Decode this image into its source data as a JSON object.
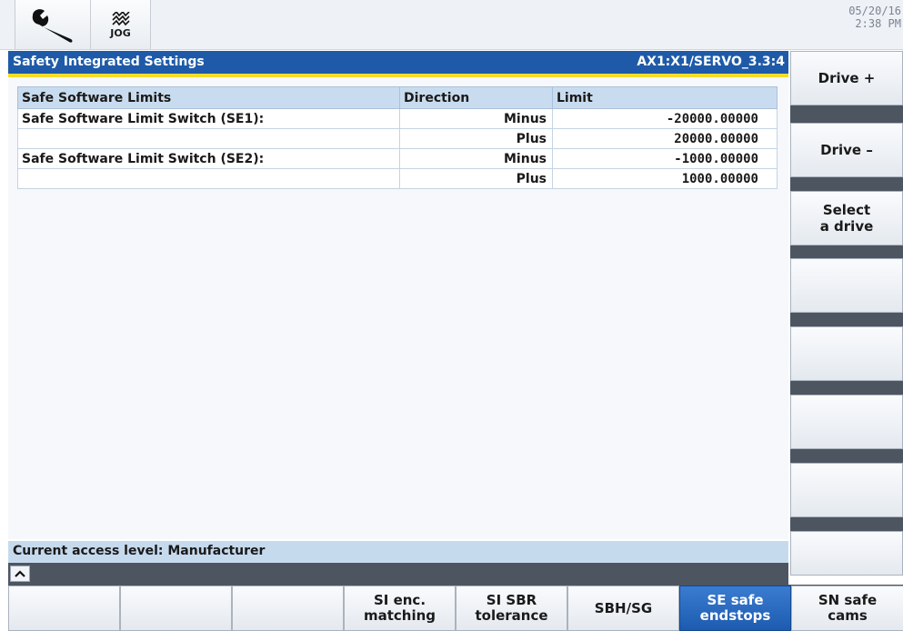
{
  "header": {
    "wrench_icon": "wrench-icon",
    "jog_icon": "jog-mode-icon",
    "jog_label": "JOG",
    "date": "05/20/16",
    "time": "2:38 PM"
  },
  "titlebar": {
    "title": "Safety Integrated Settings",
    "axis": "AX1:X1/SERVO_3.3:4"
  },
  "table": {
    "headers": [
      "Safe Software Limits",
      "Direction",
      "Limit"
    ],
    "rows": [
      {
        "name": "Safe Software Limit Switch (SE1):",
        "direction": "Minus",
        "limit": "-20000.00000"
      },
      {
        "name": "",
        "direction": "Plus",
        "limit": "20000.00000"
      },
      {
        "name": "Safe Software Limit Switch (SE2):",
        "direction": "Minus",
        "limit": "-1000.00000"
      },
      {
        "name": "",
        "direction": "Plus",
        "limit": "1000.00000"
      }
    ]
  },
  "status": {
    "access_level": "Current access level: Manufacturer",
    "caret": "^"
  },
  "right_softkeys": [
    "Drive +",
    "Drive –",
    "Select\na drive",
    "",
    "",
    "",
    "",
    ""
  ],
  "bottom_softkeys": [
    {
      "label": "",
      "active": false
    },
    {
      "label": "",
      "active": false
    },
    {
      "label": "",
      "active": false
    },
    {
      "label": "SI enc.\nmatching",
      "active": false
    },
    {
      "label": "SI SBR\ntolerance",
      "active": false
    },
    {
      "label": "SBH/SG",
      "active": false
    },
    {
      "label": "SE safe\nendstops",
      "active": true
    },
    {
      "label": "SN safe\ncams",
      "active": false
    }
  ],
  "colors": {
    "title_bar": "#1e5aa8",
    "accent_yellow": "#f4dc2a",
    "active_softkey": "#1c5bb0",
    "table_header": "#c9dcef"
  }
}
